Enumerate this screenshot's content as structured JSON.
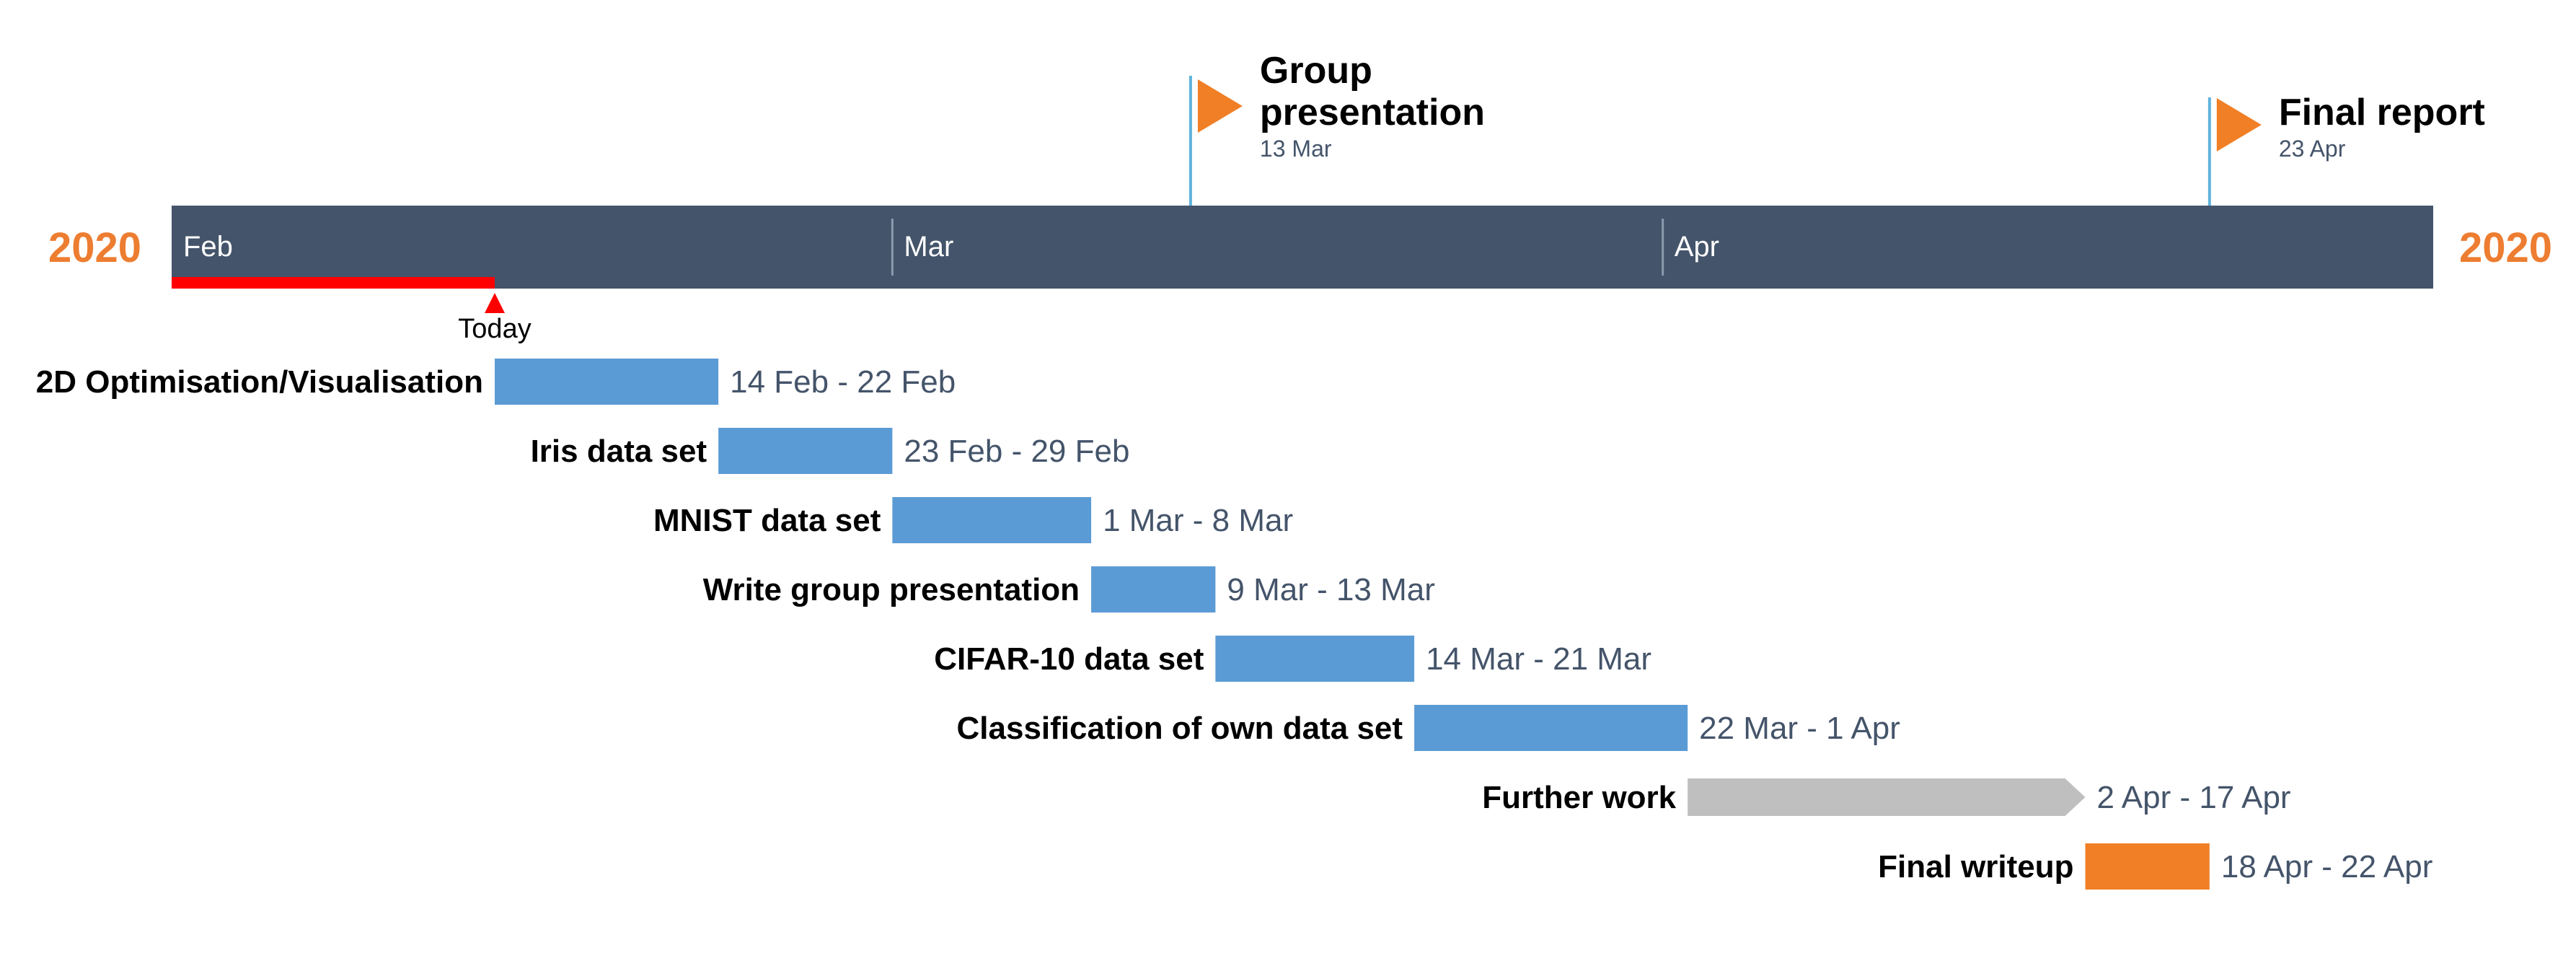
{
  "chart_data": {
    "type": "gantt",
    "year_left": "2020",
    "year_right": "2020",
    "months": [
      {
        "label": "Feb",
        "start": "2020-02-01"
      },
      {
        "label": "Mar",
        "start": "2020-03-01"
      },
      {
        "label": "Apr",
        "start": "2020-04-01"
      }
    ],
    "axis_range": [
      "2020-02-01",
      "2020-05-02"
    ],
    "today": {
      "label": "Today",
      "date": "2020-02-14"
    },
    "milestones": [
      {
        "title_lines": [
          "Group",
          "presentation"
        ],
        "date_label": "13 Mar",
        "date": "2020-03-13"
      },
      {
        "title_lines": [
          "Final report"
        ],
        "date_label": "23 Apr",
        "date": "2020-04-23"
      }
    ],
    "tasks": [
      {
        "name": "2D Optimisation/Visualisation",
        "range_label": "14 Feb - 22 Feb",
        "start": "2020-02-14",
        "end": "2020-02-22",
        "style": "bar",
        "color": "#5b9bd5"
      },
      {
        "name": "Iris data set",
        "range_label": "23 Feb - 29 Feb",
        "start": "2020-02-23",
        "end": "2020-02-29",
        "style": "bar",
        "color": "#5b9bd5"
      },
      {
        "name": "MNIST data set",
        "range_label": "1 Mar - 8 Mar",
        "start": "2020-03-01",
        "end": "2020-03-08",
        "style": "bar",
        "color": "#5b9bd5"
      },
      {
        "name": "Write group presentation",
        "range_label": "9 Mar - 13 Mar",
        "start": "2020-03-09",
        "end": "2020-03-13",
        "style": "bar",
        "color": "#5b9bd5"
      },
      {
        "name": "CIFAR-10 data set",
        "range_label": "14 Mar - 21 Mar",
        "start": "2020-03-14",
        "end": "2020-03-21",
        "style": "bar",
        "color": "#5b9bd5"
      },
      {
        "name": "Classification of own data set",
        "range_label": "22 Mar - 1 Apr",
        "start": "2020-03-22",
        "end": "2020-04-01",
        "style": "bar",
        "color": "#5b9bd5"
      },
      {
        "name": "Further work",
        "range_label": "2 Apr - 17 Apr",
        "start": "2020-04-02",
        "end": "2020-04-17",
        "style": "arrow",
        "color": "#bfbfbf"
      },
      {
        "name": "Final writeup",
        "range_label": "18 Apr - 22 Apr",
        "start": "2020-04-18",
        "end": "2020-04-22",
        "style": "bar",
        "color": "#f07f26"
      }
    ],
    "colors": {
      "timeline_band": "#44546a",
      "accent_orange": "#ed7d31",
      "milestone_flag": "#f07f26",
      "milestone_pole": "#5fb3dc",
      "today_red": "#ff0000",
      "date_text": "#44546a",
      "month_tick": "#8c9aae"
    }
  }
}
